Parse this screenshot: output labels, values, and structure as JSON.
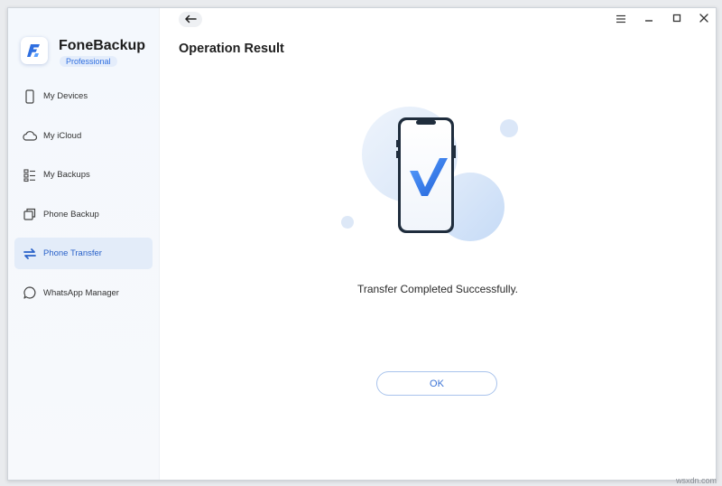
{
  "app": {
    "name": "FoneBackup",
    "edition": "Professional",
    "accent": "#2f6fe0"
  },
  "sidebar": {
    "items": [
      {
        "label": "My Devices",
        "icon": "phone-icon"
      },
      {
        "label": "My iCloud",
        "icon": "cloud-icon"
      },
      {
        "label": "My Backups",
        "icon": "list-icon"
      },
      {
        "label": "Phone Backup",
        "icon": "copy-icon"
      },
      {
        "label": "Phone Transfer",
        "icon": "transfer-icon",
        "active": true
      },
      {
        "label": "WhatsApp Manager",
        "icon": "chat-bubble-icon"
      }
    ]
  },
  "header": {
    "title": "Operation Result"
  },
  "result": {
    "message": "Transfer Completed Successfully.",
    "ok_label": "OK"
  },
  "watermark": "wsxdn.com"
}
